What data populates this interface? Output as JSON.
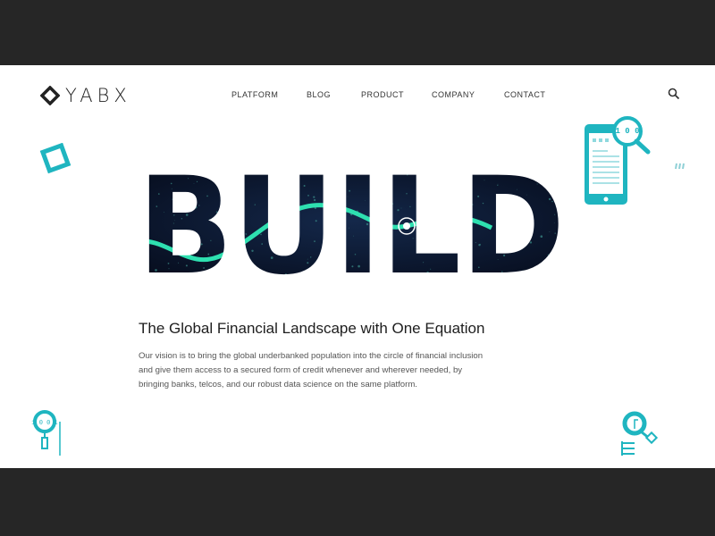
{
  "brand": {
    "name": "YABX",
    "accent": "#1fb5c0",
    "dark": "#0b1630"
  },
  "nav": {
    "items": [
      {
        "label": "PLATFORM"
      },
      {
        "label": "BLOG"
      },
      {
        "label": "PRODUCT"
      },
      {
        "label": "COMPANY"
      },
      {
        "label": "CONTACT"
      }
    ]
  },
  "header": {
    "search_icon": "search-icon"
  },
  "hero": {
    "word": "BUILD",
    "title": "The Global Financial Landscape with One Equation",
    "paragraph": "Our vision is to bring the global underbanked population into the circle of financial inclusion and give them access to a secured form of credit whenever and wherever needed, by bringing banks, telcos, and our robust data science on the same platform."
  },
  "illustrations": {
    "phone_digits": "1 0 0",
    "small_digits": "1 0 0 1"
  }
}
